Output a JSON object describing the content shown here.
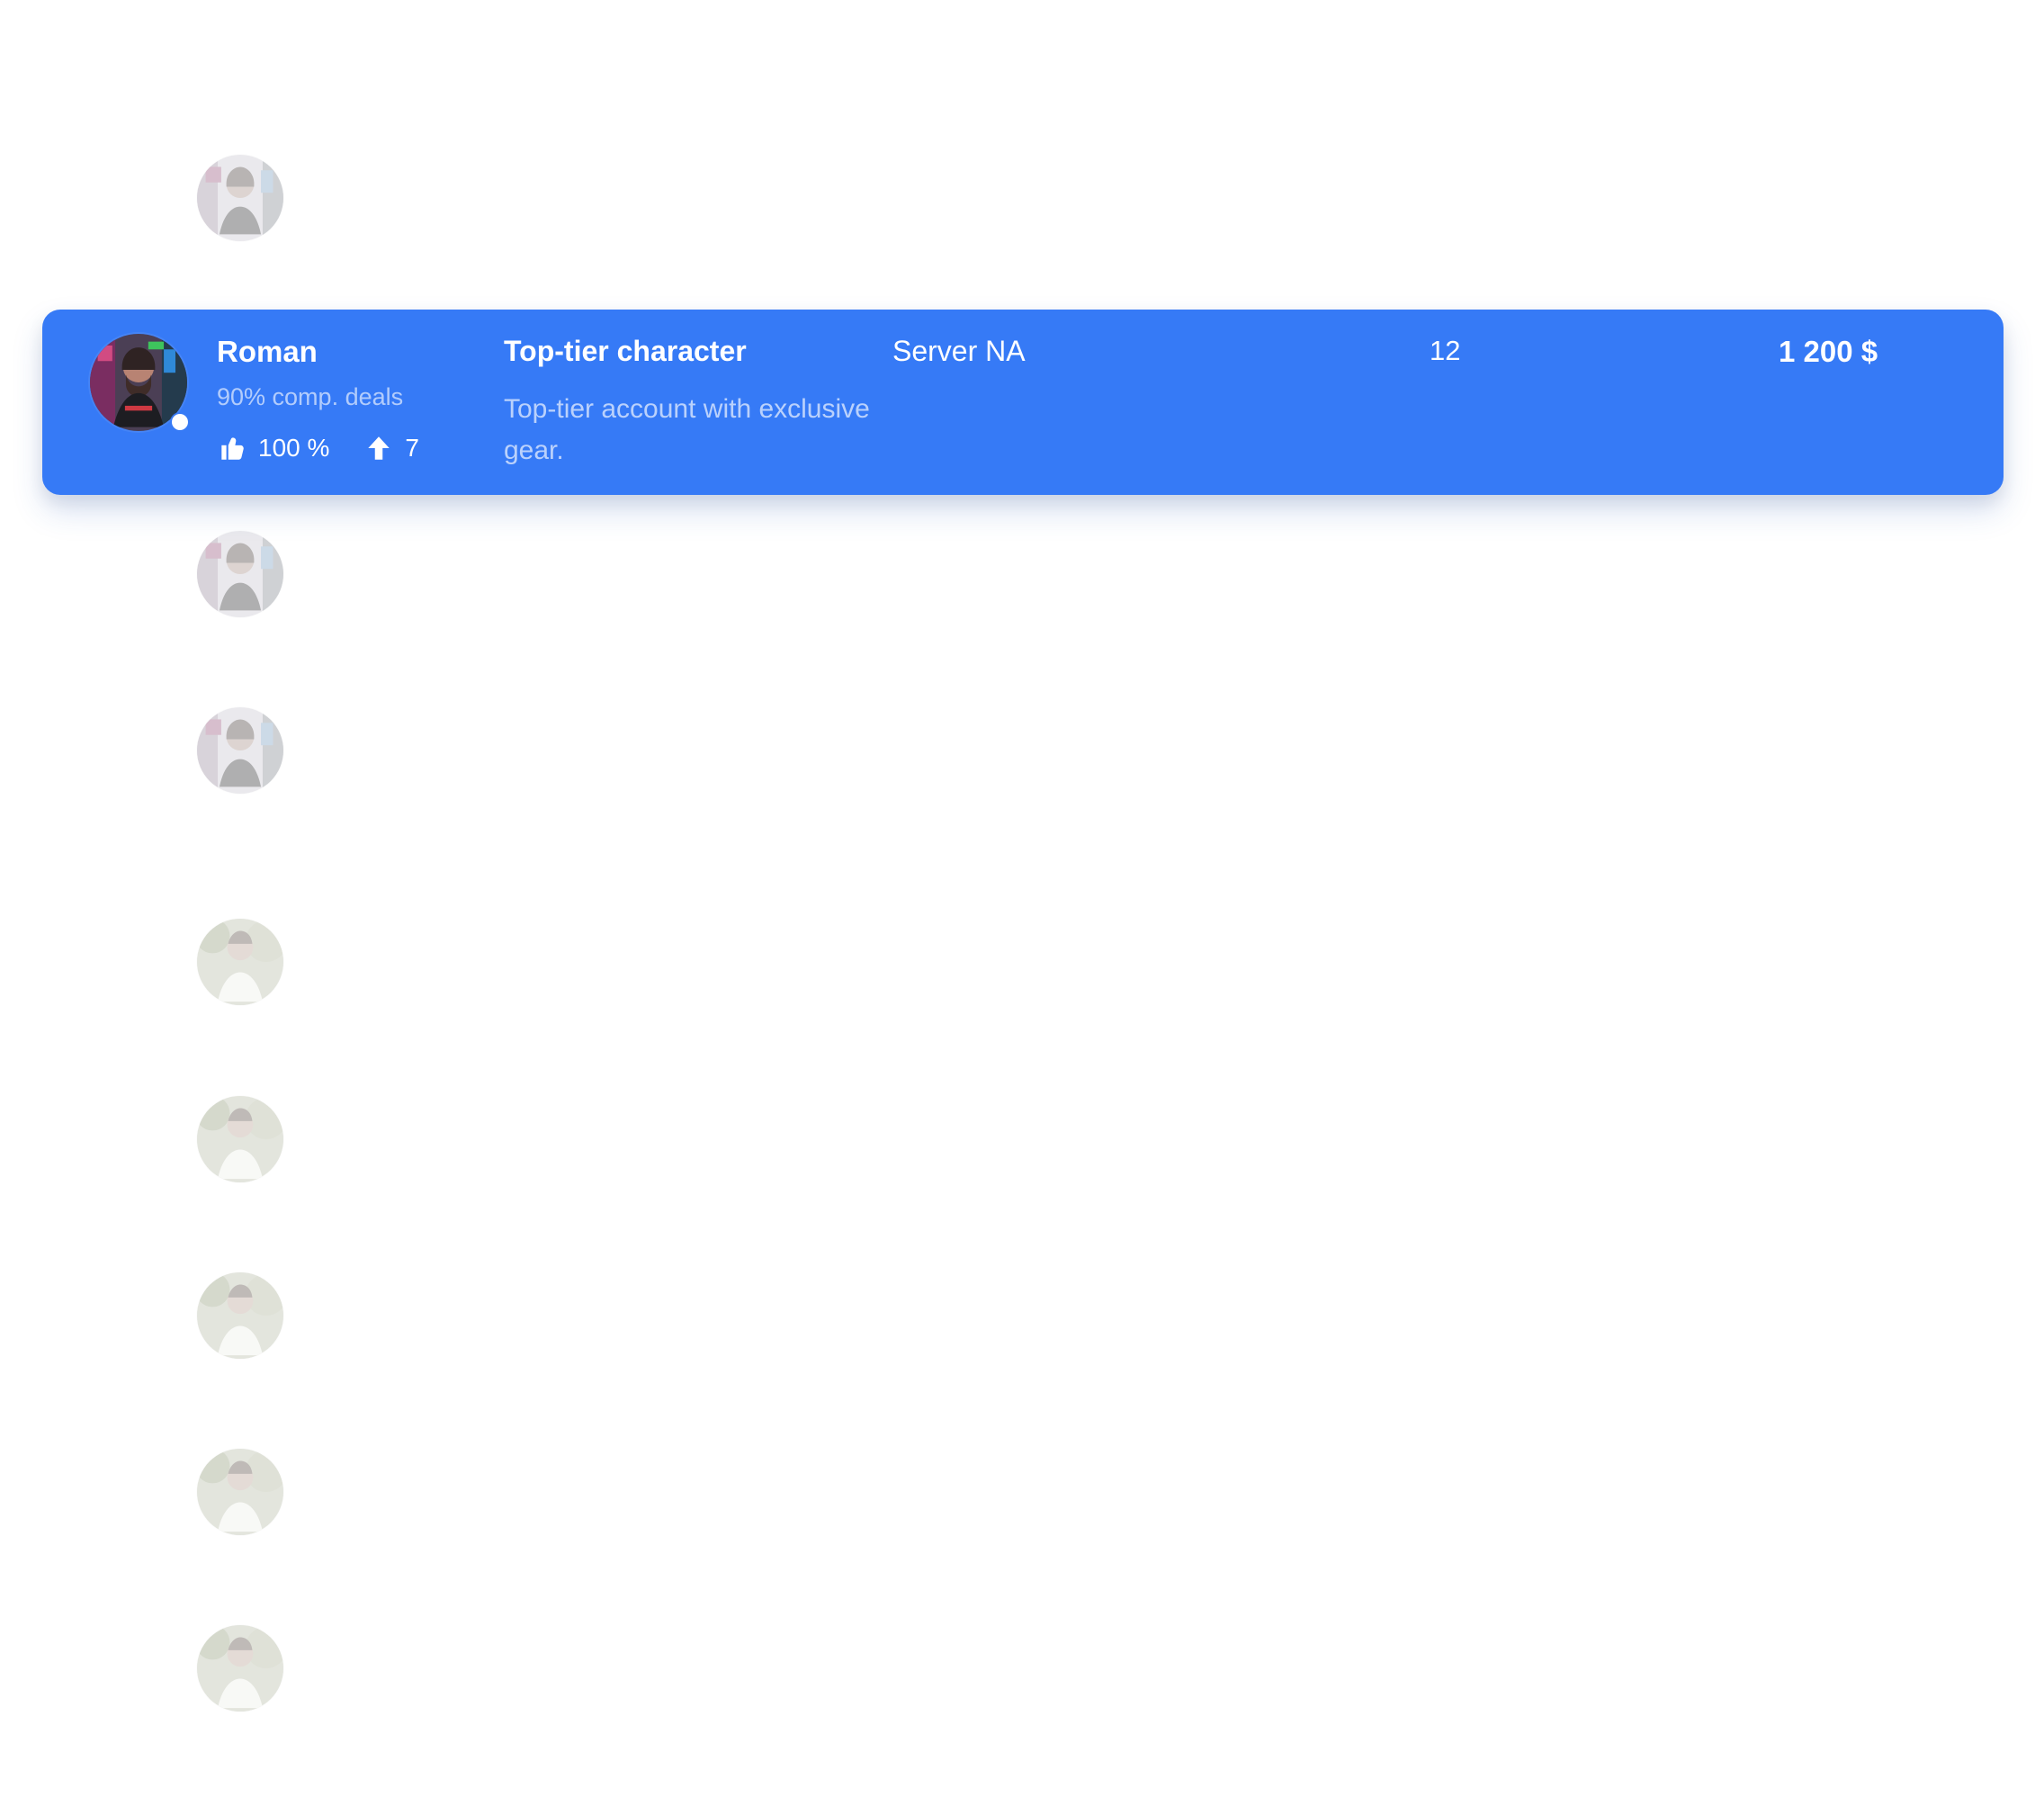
{
  "listing": {
    "seller": {
      "name": "Roman",
      "completed_deals": "90% comp. deals",
      "rating": "100 %",
      "boosts": "7"
    },
    "product": {
      "title": "Top-tier character",
      "description": "Top-tier account with exclusive gear."
    },
    "server": "Server NA",
    "quantity": "12",
    "price": "1 200 $"
  },
  "icons": {
    "rating": "thumbs-up-icon",
    "boosts": "arrow-up-icon"
  },
  "colors": {
    "accent": "#367af6",
    "background": "#ffffff",
    "text_on_accent": "#ffffff"
  }
}
